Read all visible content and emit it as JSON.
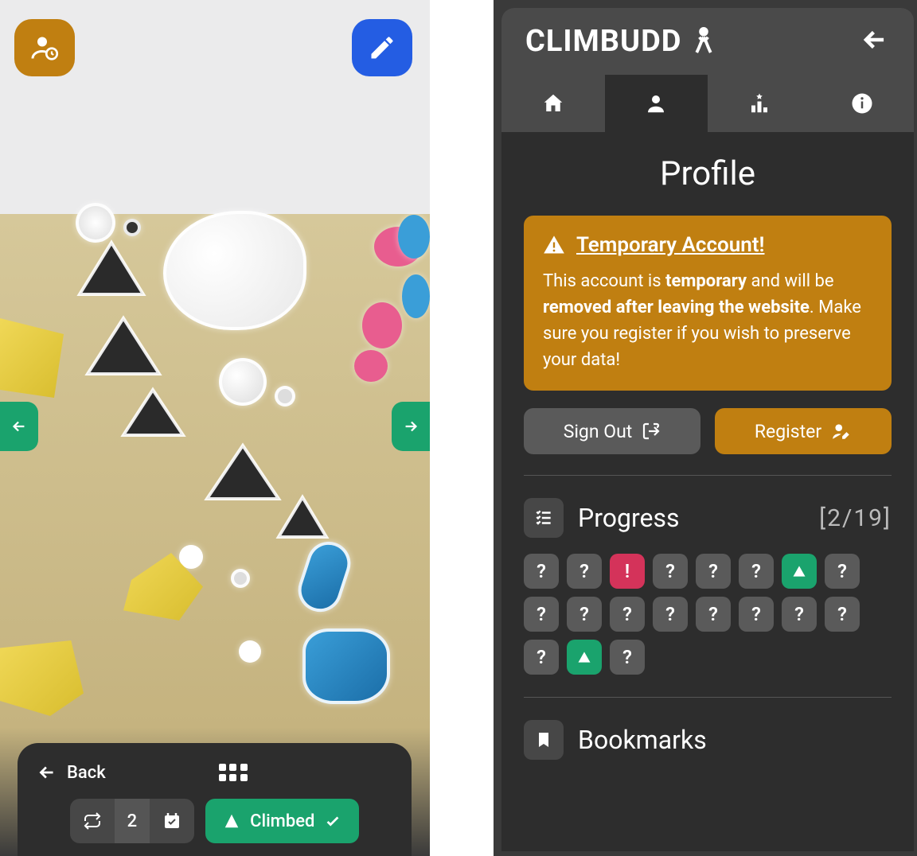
{
  "left": {
    "back_label": "Back",
    "count": "2",
    "climbed_label": "Climbed"
  },
  "right": {
    "brand": "CLIMBUDD",
    "page_title": "Profile",
    "warn_title": "Temporary Account!",
    "warn_body_1": "This account is ",
    "warn_body_b1": "temporary",
    "warn_body_2": " and will be ",
    "warn_body_b2": "removed after leaving the website",
    "warn_body_3": ". Make sure you register if you wish to preserve your data!",
    "signout_label": "Sign Out",
    "register_label": "Register",
    "progress_title": "Progress",
    "progress_count": "[2/19]",
    "bookmarks_title": "Bookmarks",
    "progress_tiles": [
      {
        "s": "u"
      },
      {
        "s": "u"
      },
      {
        "s": "f"
      },
      {
        "s": "u"
      },
      {
        "s": "u"
      },
      {
        "s": "u"
      },
      {
        "s": "d"
      },
      {
        "s": "u"
      },
      {
        "s": "u"
      },
      {
        "s": "u"
      },
      {
        "s": "u"
      },
      {
        "s": "u"
      },
      {
        "s": "u"
      },
      {
        "s": "u"
      },
      {
        "s": "u"
      },
      {
        "s": "u"
      },
      {
        "s": "u"
      },
      {
        "s": "d"
      },
      {
        "s": "u"
      }
    ]
  }
}
